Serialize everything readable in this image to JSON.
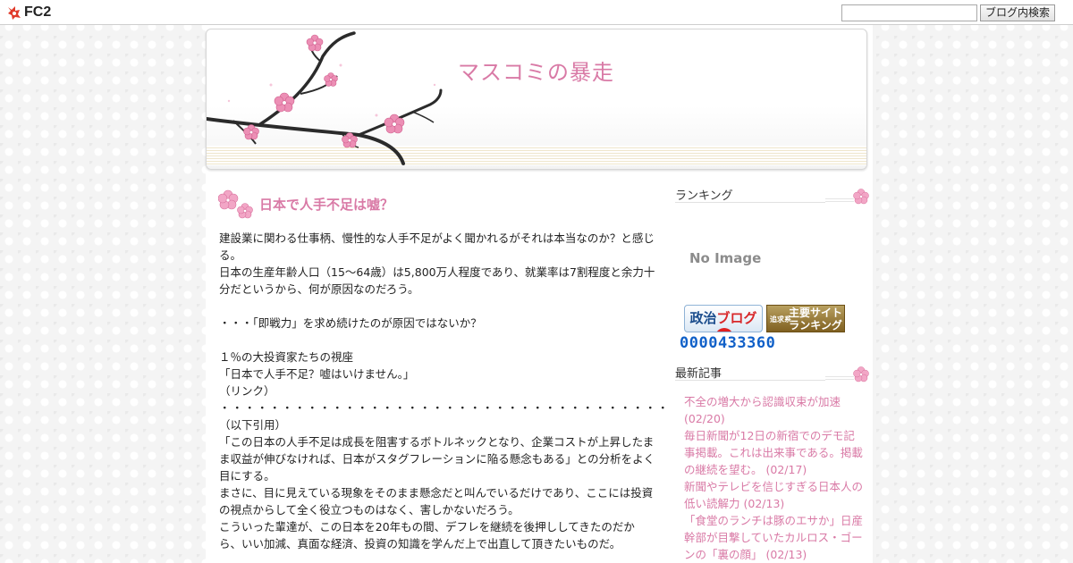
{
  "fc2": {
    "logo_text": "FC2",
    "search_placeholder": "",
    "search_button": "ブログ内検索"
  },
  "blog": {
    "title": "マスコミの暴走"
  },
  "post": {
    "title": "日本で人手不足は嘘？",
    "paragraphs": [
      "建設業に関わる仕事柄、慢性的な人手不足がよく聞かれるがそれは本当なのか？と感じる。",
      "日本の生産年齢人口（15～64歳）は5,800万人程度であり、就業率は7割程度と余力十分だというから、何が原因なのだろう。",
      "",
      "・・・「即戦力」を求め続けたのが原因ではないか？",
      "",
      "１％の大投資家たちの視座",
      "「日本で人手不足？嘘はいけません。」",
      "（リンク）",
      "・・・・・・・・・・・・・・・・・・・・・・・・・・・・・・・・・・・・",
      "（以下引用）",
      "「この日本の人手不足は成長を阻害するボトルネックとなり、企業コストが上昇したまま収益が伸びなければ、日本がスタグフレーションに陥る懸念もある」との分析をよく目にする。",
      "まさに、目に見えている現象をそのまま懸念だと叫んでいるだけであり、ここには投資の視点からして全く役立つものはなく、害しかないだろう。",
      "こういった輩達が、この日本を20年もの間、デフレを継続を後押ししてきたのだから、いい加減、真面な経済、投資の知識を学んだ上で出直して頂きたいものだ。"
    ]
  },
  "sidebar": {
    "ranking_heading": "ランキング",
    "no_image": "No Image",
    "banner1_a": "政治",
    "banner1_b": "ブログ",
    "banner2_small": "追求系",
    "banner2_line1": "主要サイト",
    "banner2_line2": "ランキング",
    "counter": "0000433360",
    "recent_heading": "最新記事",
    "recent": [
      {
        "title": "不全の増大から認識収束が加速",
        "date": "(02/20)"
      },
      {
        "title": "毎日新聞が12日の新宿でのデモ記事掲載。これは出来事である。掲載の継続を望む。",
        "date": "(02/17)"
      },
      {
        "title": "新聞やテレビを信じすぎる日本人の低い読解力",
        "date": "(02/13)"
      },
      {
        "title": "「食堂のランチは豚のエサか」日産幹部が目撃していたカルロス・ゴーンの「裏の顔」",
        "date": "(02/13)"
      }
    ]
  },
  "colors": {
    "accent_pink": "#d97aa6",
    "counter_blue": "#1060c8"
  }
}
